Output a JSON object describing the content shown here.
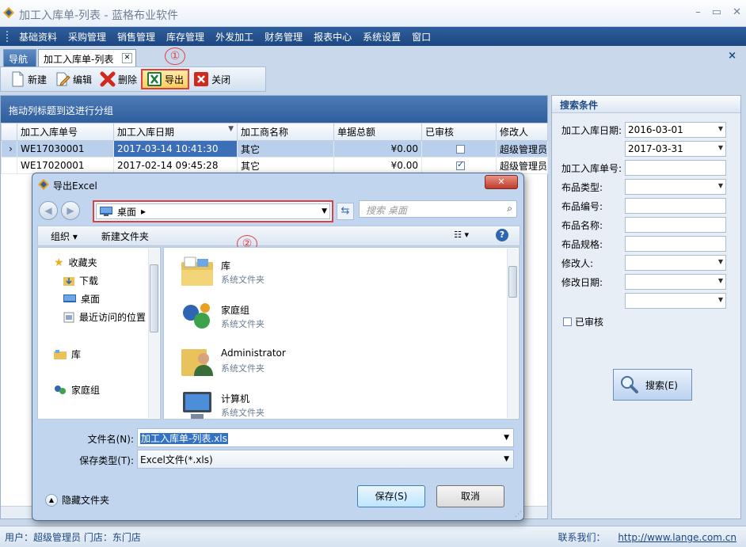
{
  "app": {
    "title": "加工入库单-列表 - 蓝格布业软件",
    "window_controls": [
      "–",
      "▭",
      "✕"
    ]
  },
  "menu": [
    "基础资料",
    "采购管理",
    "销售管理",
    "库存管理",
    "外发加工",
    "财务管理",
    "报表中心",
    "系统设置",
    "窗口"
  ],
  "tabs": [
    {
      "label": "导航"
    },
    {
      "label": "加工入库单-列表",
      "close": "✕"
    }
  ],
  "close_all": "×",
  "toolbar": {
    "new": "新建",
    "edit": "编辑",
    "delete": "删除",
    "export": "导出",
    "close": "关闭"
  },
  "markers": {
    "one": "①",
    "two": "②"
  },
  "grid": {
    "group_hint": "拖动列标题到这进行分组",
    "columns": [
      "加工入库单号",
      "加工入库日期",
      "加工商名称",
      "单据总额",
      "已审核",
      "修改人"
    ],
    "sort_glyph": "▼",
    "row_pointer": "›",
    "rows": [
      {
        "no": "WE17030001",
        "date": "2017-03-14 10:41:30",
        "vendor": "其它",
        "total": "¥0.00",
        "approved": false,
        "modifier": "超级管理员"
      },
      {
        "no": "WE17020001",
        "date": "2017-02-14 09:45:28",
        "vendor": "其它",
        "total": "¥0.00",
        "approved": true,
        "modifier": "超级管理员"
      }
    ]
  },
  "search": {
    "title": "搜索条件",
    "date_label": "加工入库日期:",
    "date_from": "2016-03-01",
    "date_to": "2017-03-31",
    "order_no_label": "加工入库单号:",
    "fabric_type_label": "布品类型:",
    "fabric_code_label": "布品编号:",
    "fabric_name_label": "布品名称:",
    "fabric_spec_label": "布品规格:",
    "modifier_label": "修改人:",
    "modified_date_label": "修改日期:",
    "approved_label": "已审核",
    "button": "搜索(E)"
  },
  "status": {
    "user": "用户：超级管理员  门店：东门店",
    "contact_label": "联系我们：",
    "url": "http://www.lange.com.cn"
  },
  "dialog": {
    "title": "导出Excel",
    "close": "✕",
    "address": "桌面",
    "address_arrow": "▸",
    "search_placeholder": "搜索 桌面",
    "organize": "组织 ▾",
    "new_folder": "新建文件夹",
    "nav": {
      "favorites": "收藏夹",
      "downloads": "下载",
      "desktop": "桌面",
      "recent": "最近访问的位置",
      "libraries": "库",
      "homegroup": "家庭组"
    },
    "items": [
      {
        "name": "库",
        "type": "系统文件夹",
        "icon": "library-icon"
      },
      {
        "name": "家庭组",
        "type": "系统文件夹",
        "icon": "homegroup-icon"
      },
      {
        "name": "Administrator",
        "type": "系统文件夹",
        "icon": "user-folder-icon"
      },
      {
        "name": "计算机",
        "type": "系统文件夹",
        "icon": "computer-icon"
      }
    ],
    "filename_label": "文件名(N):",
    "filename": "加工入库单-列表.xls",
    "filetype_label": "保存类型(T):",
    "filetype": "Excel文件(*.xls)",
    "hide_folders": "隐藏文件夹",
    "save": "保存(S)",
    "cancel": "取消"
  },
  "colors": {
    "menubar": "#1d4781",
    "highlight": "#e04040",
    "selection": "#3d6fb8"
  }
}
